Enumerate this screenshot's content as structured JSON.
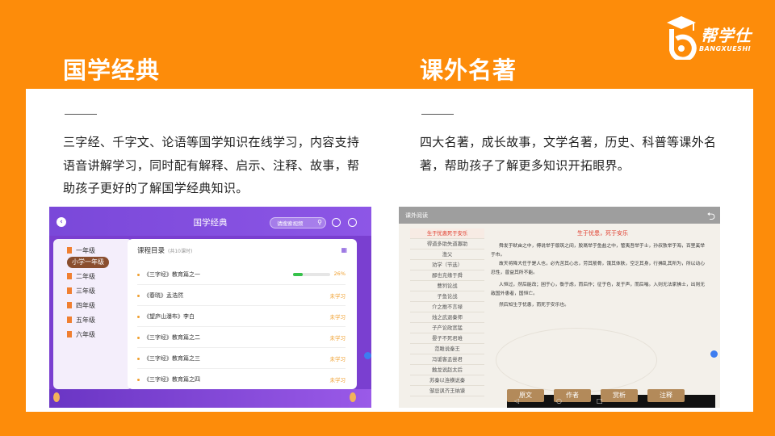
{
  "logo": {
    "text": "帮学仕",
    "sub": "BANGXUESHI"
  },
  "left_section": {
    "title": "国学经典",
    "description": "三字经、千字文、论语等国学知识在线学习，内容支持语音讲解学习，同时配有解释、启示、注释、故事，帮助孩子更好的了解国学经典知识。"
  },
  "right_section": {
    "title": "课外名著",
    "description": "四大名著，成长故事，文学名著，历史、科普等课外名著，帮助孩子了解更多知识开拓眼界。"
  },
  "app1": {
    "title": "国学经典",
    "search_placeholder": "请搜索视频",
    "grades": [
      "一年级",
      "小学一年级",
      "二年级",
      "三年级",
      "四年级",
      "五年级",
      "六年级"
    ],
    "selected_grade_index": 1,
    "course_header": "课程目录",
    "course_count": "(共10课时)",
    "lessons": [
      {
        "name": "《三字经》教育篇之一",
        "status": "26%",
        "progress": 0.26
      },
      {
        "name": "《春晓》孟浩然",
        "status": "未学习"
      },
      {
        "name": "《望庐山瀑布》李白",
        "status": "未学习"
      },
      {
        "name": "《三字经》教育篇之二",
        "status": "未学习"
      },
      {
        "name": "《三字经》教育篇之三",
        "status": "未学习"
      },
      {
        "name": "《三字经》教育篇之四",
        "status": "未学习"
      }
    ]
  },
  "app2": {
    "title": "课外阅读",
    "chapters": [
      "生于忧患死于安乐",
      "得道多助失道寡助",
      "渔父",
      "劝学（节选）",
      "鄙也克缘于舜",
      "曹刿论战",
      "子鱼论战",
      "介之推不言禄",
      "烛之武退秦师",
      "子产论政宽猛",
      "晏子不死君难",
      "范雎说秦王",
      "冯谖客孟尝君",
      "触龙说赵太后",
      "苏秦以连横说秦",
      "邹忌讽齐王纳谏"
    ],
    "selected_chapter_index": 0,
    "heading": "生于忧患，死于安乐",
    "paragraphs": [
      "舜发于畎亩之中，傅说举于版筑之间，胶鬲举于鱼盐之中，管夷吾举于士，孙叔敖举于海，百里奚举于市。",
      "故天将降大任于是人也，必先苦其心志，劳其筋骨，饿其体肤，空乏其身，行拂乱其所为，所以动心忍性，曾益其所不能。",
      "人恒过，然后能改；困于心，衡于虑，而后作；征于色，发于声，而后喻。入则无法家拂士，出则无敌国外患者，国恒亡。",
      "然后知生于忧患，而死于安乐也。"
    ],
    "tabs": [
      "原文",
      "作者",
      "赏析",
      "注释"
    ]
  }
}
